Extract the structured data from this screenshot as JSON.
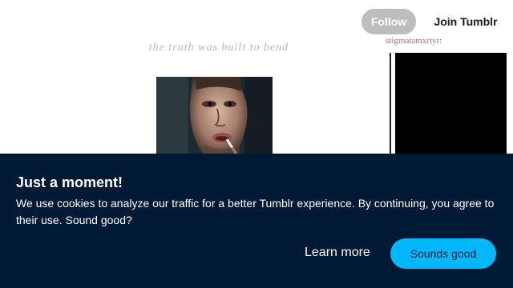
{
  "header": {
    "follow_label": "Follow",
    "join_label": "Join Tumblr"
  },
  "blog": {
    "description": "the truth was built to bend"
  },
  "post": {
    "image_icon": "portrait-photo"
  },
  "reblog": {
    "username": "stigmatamxrtyr",
    "separator": ":"
  },
  "cookie_banner": {
    "title": "Just a moment!",
    "body": "We use cookies to analyze our traffic for a better Tumblr experience. By continuing, you agree to their use. Sound good?",
    "learn_more_label": "Learn more",
    "accept_label": "Sounds good",
    "background_color": "#001935",
    "accent_color": "#00b8ff"
  }
}
